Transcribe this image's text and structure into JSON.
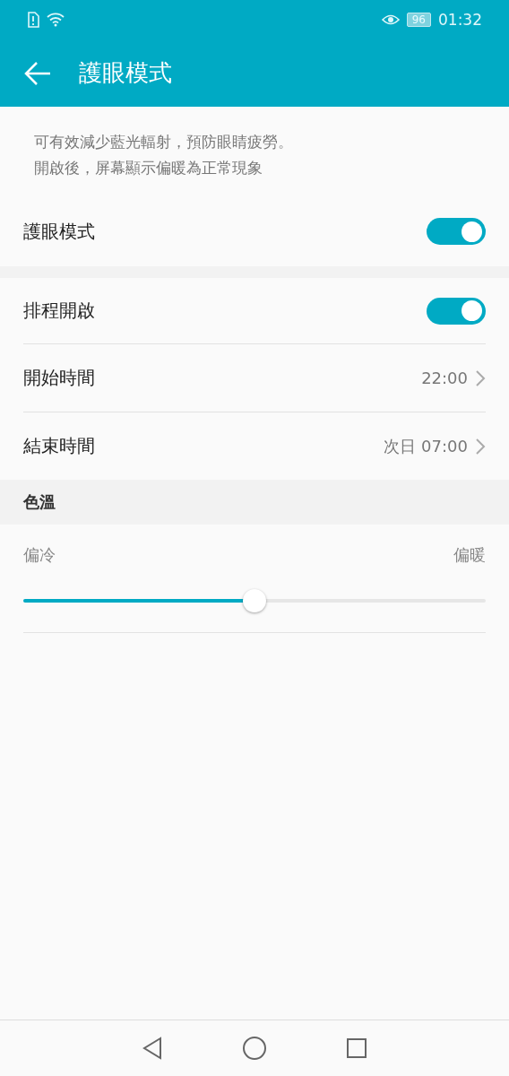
{
  "status_bar": {
    "battery": "96",
    "time": "01:32"
  },
  "header": {
    "title": "護眼模式"
  },
  "intro": [
    "可有效減少藍光輻射，預防眼睛疲勞。",
    "開啟後，屏幕顯示偏暖為正常現象"
  ],
  "main_toggle": {
    "label": "護眼模式",
    "on": true
  },
  "schedule": [
    {
      "kind": "toggle",
      "label": "排程開啟",
      "on": true
    },
    {
      "kind": "link",
      "label": "開始時間",
      "value": "22:00"
    },
    {
      "kind": "link",
      "label": "結束時間",
      "value": "次日 07:00"
    }
  ],
  "color_temperature": {
    "title": "色溫",
    "min_label": "偏冷",
    "max_label": "偏暖",
    "level": 0.5
  }
}
